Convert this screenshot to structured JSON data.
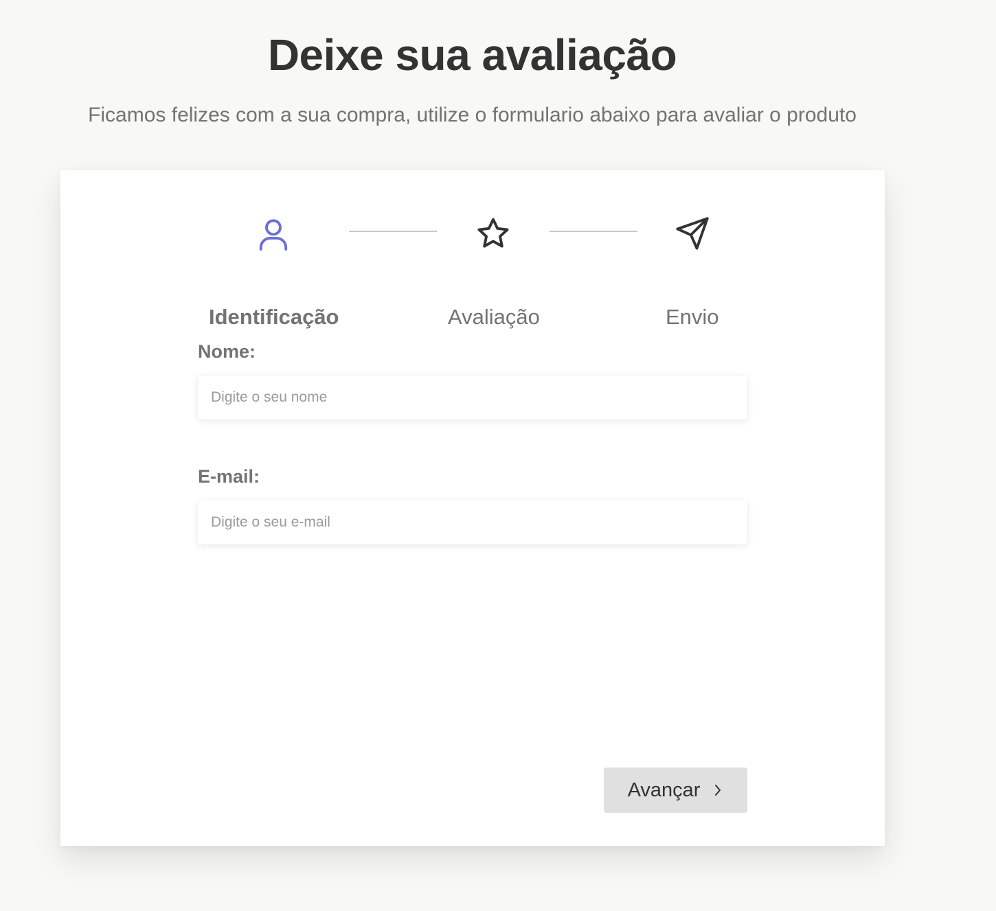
{
  "header": {
    "title": "Deixe sua avaliação",
    "subtitle": "Ficamos felizes com a sua compra, utilize o formulario abaixo para avaliar o produto"
  },
  "steps": [
    {
      "label": "Identificação",
      "icon": "user-icon",
      "active": true
    },
    {
      "label": "Avaliação",
      "icon": "star-icon",
      "active": false
    },
    {
      "label": "Envio",
      "icon": "send-icon",
      "active": false
    }
  ],
  "form": {
    "name_label": "Nome:",
    "name_placeholder": "Digite o seu nome",
    "name_value": "",
    "email_label": "E-mail:",
    "email_placeholder": "Digite o seu e-mail",
    "email_value": ""
  },
  "actions": {
    "next_label": "Avançar",
    "next_icon": "chevron-right-icon"
  },
  "colors": {
    "background": "#f8f8f4",
    "card": "#ffffff",
    "title": "#333333",
    "muted_text": "#737373",
    "active_step": "#6b6fd6",
    "button_bg": "#e0e0e0"
  }
}
